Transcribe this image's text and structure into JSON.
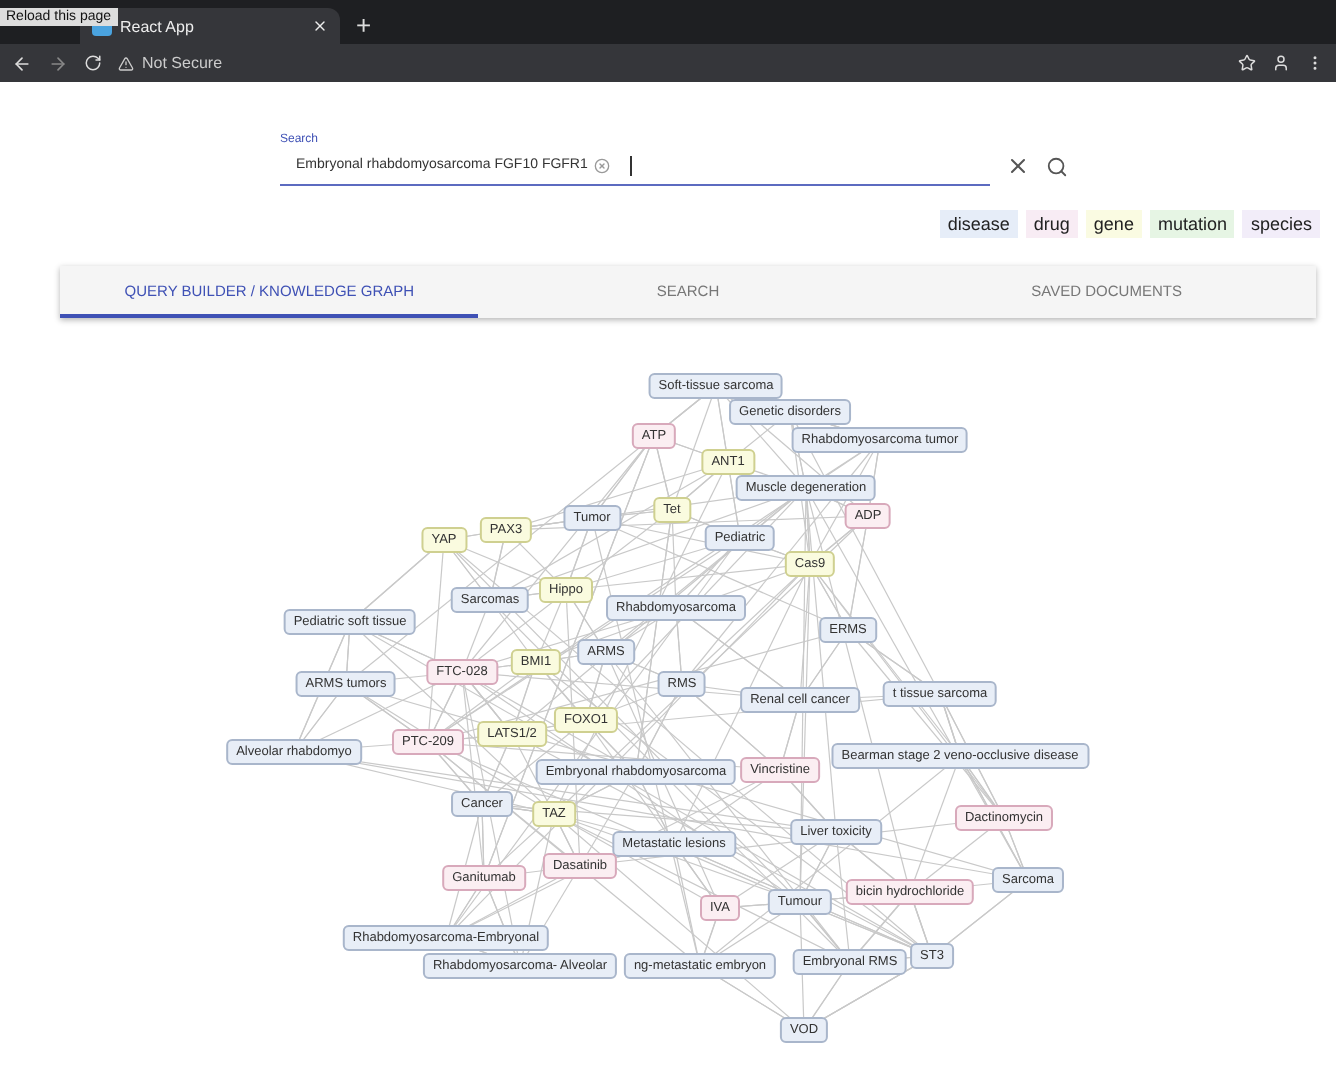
{
  "browser": {
    "tooltip": "Reload this page",
    "tab_title": "React App",
    "new_tab": "+",
    "address": "Not Secure"
  },
  "search": {
    "label": "Search",
    "chips": [
      {
        "text": "Embryonal rhabdomyosarcoma FGF10 FGFR1"
      }
    ]
  },
  "legend": [
    {
      "label": "disease",
      "color": "#e6edf8"
    },
    {
      "label": "drug",
      "color": "#f8ecf4"
    },
    {
      "label": "gene",
      "color": "#fafbe2"
    },
    {
      "label": "mutation",
      "color": "#e6f5e4"
    },
    {
      "label": "species",
      "color": "#f2edf9"
    }
  ],
  "tabs": [
    {
      "label": "QUERY BUILDER / KNOWLEDGE GRAPH",
      "selected": true
    },
    {
      "label": "SEARCH",
      "selected": false
    },
    {
      "label": "SAVED DOCUMENTS",
      "selected": false
    }
  ],
  "graph": {
    "nodes": [
      {
        "label": "Soft-tissue sarcoma",
        "kind": "disease"
      },
      {
        "label": "Genetic disorders",
        "kind": "disease"
      },
      {
        "label": "ATP",
        "kind": "drug"
      },
      {
        "label": "Rhabdomyosarcoma tumor",
        "kind": "disease"
      },
      {
        "label": "ANT1",
        "kind": "gene"
      },
      {
        "label": "Muscle degeneration",
        "kind": "disease"
      },
      {
        "label": "YAP",
        "kind": "gene"
      },
      {
        "label": "PAX3",
        "kind": "gene"
      },
      {
        "label": "Tumor",
        "kind": "disease"
      },
      {
        "label": "Tet",
        "kind": "gene"
      },
      {
        "label": "Pediatric",
        "kind": "disease"
      },
      {
        "label": "ADP",
        "kind": "drug"
      },
      {
        "label": "Cas9",
        "kind": "gene"
      },
      {
        "label": "Pediatric soft tissue",
        "kind": "disease"
      },
      {
        "label": "Sarcomas",
        "kind": "disease"
      },
      {
        "label": "Hippo",
        "kind": "gene"
      },
      {
        "label": "Rhabdomyosarcoma",
        "kind": "disease"
      },
      {
        "label": "ERMS",
        "kind": "disease"
      },
      {
        "label": "ARMS tumors",
        "kind": "disease"
      },
      {
        "label": "FTC-028",
        "kind": "drug"
      },
      {
        "label": "BMI1",
        "kind": "gene"
      },
      {
        "label": "ARMS",
        "kind": "disease"
      },
      {
        "label": "RMS",
        "kind": "disease"
      },
      {
        "label": "Renal cell cancer",
        "kind": "disease"
      },
      {
        "label": "t tissue sarcoma",
        "kind": "disease"
      },
      {
        "label": "Alveolar rhabdomyo",
        "kind": "disease"
      },
      {
        "label": "PTC-209",
        "kind": "drug"
      },
      {
        "label": "LATS1/2",
        "kind": "gene"
      },
      {
        "label": "FOXO1",
        "kind": "gene"
      },
      {
        "label": "Bearman stage 2 veno-occlusive disease",
        "kind": "disease"
      },
      {
        "label": "Embryonal rhabdomyosarcoma",
        "kind": "disease"
      },
      {
        "label": "Vincristine",
        "kind": "drug"
      },
      {
        "label": "Cancer",
        "kind": "disease"
      },
      {
        "label": "TAZ",
        "kind": "gene"
      },
      {
        "label": "Metastatic lesions",
        "kind": "disease"
      },
      {
        "label": "Liver toxicity",
        "kind": "disease"
      },
      {
        "label": "Dactinomycin",
        "kind": "drug"
      },
      {
        "label": "Ganitumab",
        "kind": "drug"
      },
      {
        "label": "Dasatinib",
        "kind": "drug"
      },
      {
        "label": "IVA",
        "kind": "drug"
      },
      {
        "label": "Tumour",
        "kind": "disease"
      },
      {
        "label": "bicin hydrochloride",
        "kind": "drug"
      },
      {
        "label": "Sarcoma",
        "kind": "disease"
      },
      {
        "label": "Rhabdomyosarcoma-Embryonal",
        "kind": "disease"
      },
      {
        "label": "Rhabdomyosarcoma- Alveolar",
        "kind": "disease"
      },
      {
        "label": "ng-metastatic embryon",
        "kind": "disease"
      },
      {
        "label": "Embryonal RMS",
        "kind": "disease"
      },
      {
        "label": "ST3",
        "kind": "disease"
      },
      {
        "label": "VOD",
        "kind": "disease"
      }
    ]
  }
}
